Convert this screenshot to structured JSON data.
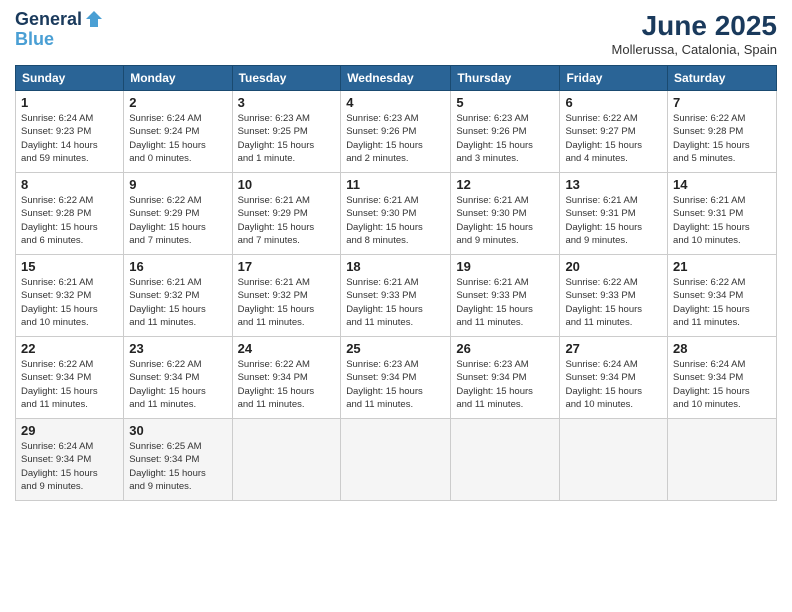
{
  "logo": {
    "line1": "General",
    "line2": "Blue"
  },
  "title": "June 2025",
  "subtitle": "Mollerussa, Catalonia, Spain",
  "days_header": [
    "Sunday",
    "Monday",
    "Tuesday",
    "Wednesday",
    "Thursday",
    "Friday",
    "Saturday"
  ],
  "weeks": [
    [
      {
        "day": "1",
        "info": "Sunrise: 6:24 AM\nSunset: 9:23 PM\nDaylight: 14 hours\nand 59 minutes."
      },
      {
        "day": "2",
        "info": "Sunrise: 6:24 AM\nSunset: 9:24 PM\nDaylight: 15 hours\nand 0 minutes."
      },
      {
        "day": "3",
        "info": "Sunrise: 6:23 AM\nSunset: 9:25 PM\nDaylight: 15 hours\nand 1 minute."
      },
      {
        "day": "4",
        "info": "Sunrise: 6:23 AM\nSunset: 9:26 PM\nDaylight: 15 hours\nand 2 minutes."
      },
      {
        "day": "5",
        "info": "Sunrise: 6:23 AM\nSunset: 9:26 PM\nDaylight: 15 hours\nand 3 minutes."
      },
      {
        "day": "6",
        "info": "Sunrise: 6:22 AM\nSunset: 9:27 PM\nDaylight: 15 hours\nand 4 minutes."
      },
      {
        "day": "7",
        "info": "Sunrise: 6:22 AM\nSunset: 9:28 PM\nDaylight: 15 hours\nand 5 minutes."
      }
    ],
    [
      {
        "day": "8",
        "info": "Sunrise: 6:22 AM\nSunset: 9:28 PM\nDaylight: 15 hours\nand 6 minutes."
      },
      {
        "day": "9",
        "info": "Sunrise: 6:22 AM\nSunset: 9:29 PM\nDaylight: 15 hours\nand 7 minutes."
      },
      {
        "day": "10",
        "info": "Sunrise: 6:21 AM\nSunset: 9:29 PM\nDaylight: 15 hours\nand 7 minutes."
      },
      {
        "day": "11",
        "info": "Sunrise: 6:21 AM\nSunset: 9:30 PM\nDaylight: 15 hours\nand 8 minutes."
      },
      {
        "day": "12",
        "info": "Sunrise: 6:21 AM\nSunset: 9:30 PM\nDaylight: 15 hours\nand 9 minutes."
      },
      {
        "day": "13",
        "info": "Sunrise: 6:21 AM\nSunset: 9:31 PM\nDaylight: 15 hours\nand 9 minutes."
      },
      {
        "day": "14",
        "info": "Sunrise: 6:21 AM\nSunset: 9:31 PM\nDaylight: 15 hours\nand 10 minutes."
      }
    ],
    [
      {
        "day": "15",
        "info": "Sunrise: 6:21 AM\nSunset: 9:32 PM\nDaylight: 15 hours\nand 10 minutes."
      },
      {
        "day": "16",
        "info": "Sunrise: 6:21 AM\nSunset: 9:32 PM\nDaylight: 15 hours\nand 11 minutes."
      },
      {
        "day": "17",
        "info": "Sunrise: 6:21 AM\nSunset: 9:32 PM\nDaylight: 15 hours\nand 11 minutes."
      },
      {
        "day": "18",
        "info": "Sunrise: 6:21 AM\nSunset: 9:33 PM\nDaylight: 15 hours\nand 11 minutes."
      },
      {
        "day": "19",
        "info": "Sunrise: 6:21 AM\nSunset: 9:33 PM\nDaylight: 15 hours\nand 11 minutes."
      },
      {
        "day": "20",
        "info": "Sunrise: 6:22 AM\nSunset: 9:33 PM\nDaylight: 15 hours\nand 11 minutes."
      },
      {
        "day": "21",
        "info": "Sunrise: 6:22 AM\nSunset: 9:34 PM\nDaylight: 15 hours\nand 11 minutes."
      }
    ],
    [
      {
        "day": "22",
        "info": "Sunrise: 6:22 AM\nSunset: 9:34 PM\nDaylight: 15 hours\nand 11 minutes."
      },
      {
        "day": "23",
        "info": "Sunrise: 6:22 AM\nSunset: 9:34 PM\nDaylight: 15 hours\nand 11 minutes."
      },
      {
        "day": "24",
        "info": "Sunrise: 6:22 AM\nSunset: 9:34 PM\nDaylight: 15 hours\nand 11 minutes."
      },
      {
        "day": "25",
        "info": "Sunrise: 6:23 AM\nSunset: 9:34 PM\nDaylight: 15 hours\nand 11 minutes."
      },
      {
        "day": "26",
        "info": "Sunrise: 6:23 AM\nSunset: 9:34 PM\nDaylight: 15 hours\nand 11 minutes."
      },
      {
        "day": "27",
        "info": "Sunrise: 6:24 AM\nSunset: 9:34 PM\nDaylight: 15 hours\nand 10 minutes."
      },
      {
        "day": "28",
        "info": "Sunrise: 6:24 AM\nSunset: 9:34 PM\nDaylight: 15 hours\nand 10 minutes."
      }
    ],
    [
      {
        "day": "29",
        "info": "Sunrise: 6:24 AM\nSunset: 9:34 PM\nDaylight: 15 hours\nand 9 minutes."
      },
      {
        "day": "30",
        "info": "Sunrise: 6:25 AM\nSunset: 9:34 PM\nDaylight: 15 hours\nand 9 minutes."
      },
      null,
      null,
      null,
      null,
      null
    ]
  ]
}
